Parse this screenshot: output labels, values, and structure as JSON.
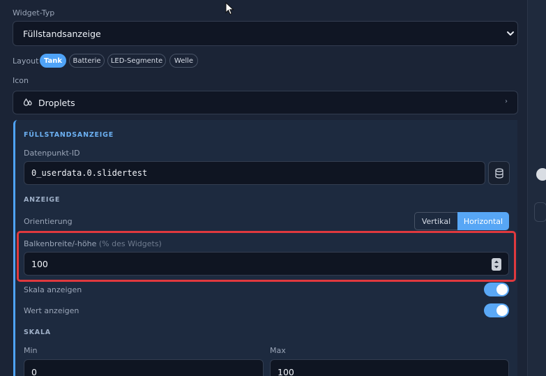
{
  "widget_type": {
    "label": "Widget-Typ",
    "value": "Füllstandsanzeige"
  },
  "layout": {
    "label": "Layout",
    "options": [
      "Tank",
      "Batterie",
      "LED-Segmente",
      "Welle"
    ],
    "selected": "Tank"
  },
  "icon": {
    "label": "Icon",
    "value": "Droplets",
    "icon_name": "droplets-icon"
  },
  "section": {
    "title": "FÜLLSTANDSANZEIGE",
    "datapoint": {
      "label": "Datenpunkt-ID",
      "value": "0_userdata.0.slidertest",
      "button_icon": "database-icon"
    },
    "display": {
      "title": "ANZEIGE",
      "orientation": {
        "label": "Orientierung",
        "options": [
          "Vertikal",
          "Horizontal"
        ],
        "selected": "Horizontal"
      },
      "bar_size": {
        "label": "Balkenbreite/-höhe",
        "hint": "(% des Widgets)",
        "value": "100"
      },
      "show_scale": {
        "label": "Skala anzeigen",
        "on": true
      },
      "show_value": {
        "label": "Wert anzeigen",
        "on": true
      }
    },
    "scale": {
      "title": "SKALA",
      "min": {
        "label": "Min",
        "value": "0"
      },
      "max": {
        "label": "Max",
        "value": "100"
      }
    }
  },
  "colors": {
    "accent": "#4fa3f7",
    "highlight": "#e0393e",
    "panel": "#1b2436"
  }
}
